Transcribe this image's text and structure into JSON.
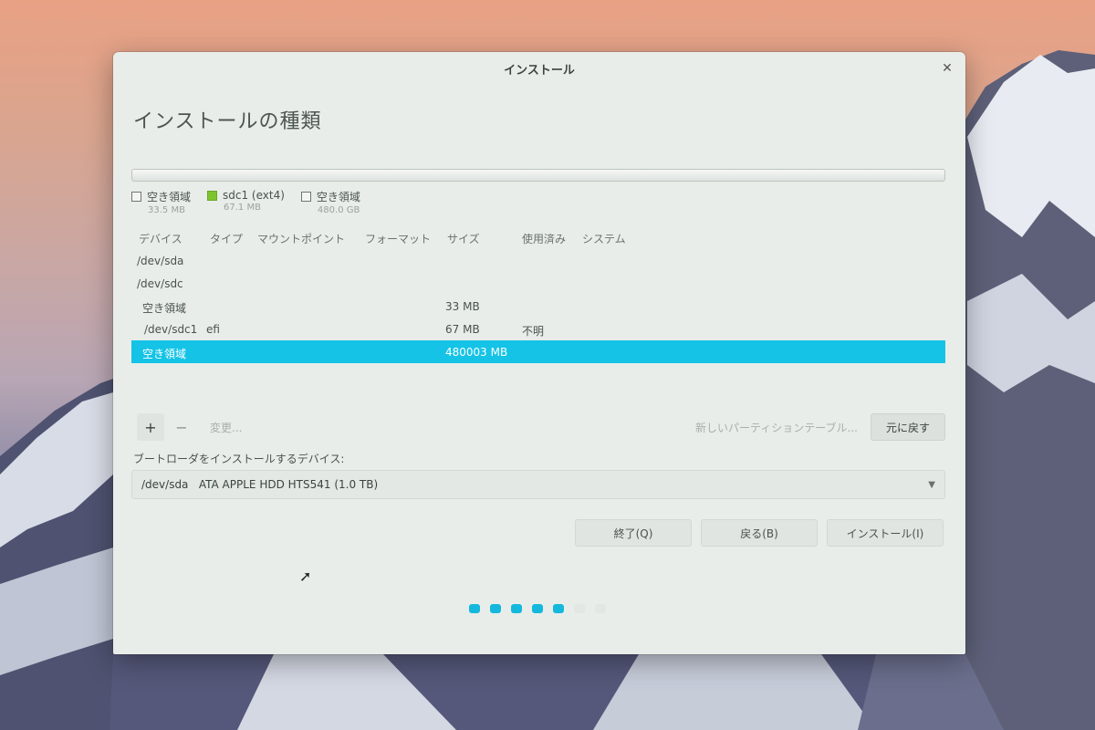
{
  "window": {
    "title": "インストール"
  },
  "page": {
    "heading": "インストールの種類"
  },
  "legend": [
    {
      "label": "空き領域",
      "size": "33.5 MB",
      "color": "#f3f5f3"
    },
    {
      "label": "sdc1 (ext4)",
      "size": "67.1 MB",
      "color": "#7dc42e"
    },
    {
      "label": "空き領域",
      "size": "480.0 GB",
      "color": "#f3f5f3"
    }
  ],
  "table": {
    "headers": [
      "デバイス",
      "タイプ",
      "マウントポイント",
      "フォーマット",
      "サイズ",
      "使用済み",
      "システム"
    ],
    "rows": [
      {
        "device": "/dev/sda",
        "type": "",
        "size": "",
        "used": ""
      },
      {
        "device": "/dev/sdc",
        "type": "",
        "size": "",
        "used": ""
      },
      {
        "device": "空き領域",
        "type": "",
        "size": "33 MB",
        "used": ""
      },
      {
        "device": "/dev/sdc1",
        "type": "efi",
        "size": "67 MB",
        "used": "不明"
      },
      {
        "device": "空き領域",
        "type": "",
        "size": "480003 MB",
        "used": "",
        "selected": true
      }
    ]
  },
  "toolbar": {
    "add": "+",
    "remove": "−",
    "change": "変更...",
    "new_table": "新しいパーティションテーブル...",
    "revert": "元に戻す"
  },
  "bootloader": {
    "label": "ブートローダをインストールするデバイス:",
    "value": "/dev/sda   ATA APPLE HDD HTS541 (1.0 TB)"
  },
  "buttons": {
    "quit": "終了(Q)",
    "back": "戻る(B)",
    "install": "インストール(I)"
  },
  "progress": {
    "completed_steps": 5,
    "total_steps": 7
  },
  "colors": {
    "accent": "#14c3e6",
    "ext4": "#7dc42e"
  }
}
